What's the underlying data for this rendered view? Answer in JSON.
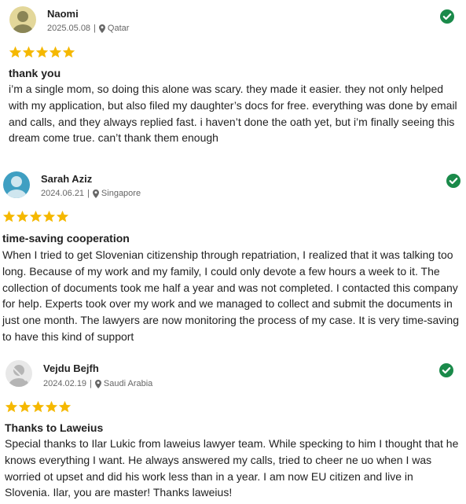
{
  "colors": {
    "star": "#f5b800",
    "verified": "#1a8a4a",
    "meta": "#666666"
  },
  "reviews": [
    {
      "name": "Naomi",
      "date": "2025.05.08",
      "country": "Qatar",
      "rating": 5,
      "title": "thank you",
      "text": "i’m a single mom, so doing this alone was scary. they made it easier. they not only helped with my application, but also filed my daughter’s docs for free. everything was done by email and calls, and they always replied fast. i haven’t done the oath yet, but i’m finally seeing this dream come true. can’t thank them enough",
      "verified_icon": "check-circle-icon"
    },
    {
      "name": "Sarah Aziz",
      "date": "2024.06.21",
      "country": "Singapore",
      "rating": 5,
      "title": "time-saving cooperation",
      "text": "When I tried to get Slovenian citizenship through repatriation, I realized that it was talking too long. Because of my work and my family, I could only devote a few hours a week to it. The collection of documents took me half a year and was not completed. I contacted this company for help. Experts took over my work and we managed to collect and submit the documents in just one month. The lawyers are now monitoring the process of my case. It is very time-saving to have this kind of support",
      "verified_icon": "check-circle-icon"
    },
    {
      "name": "Vejdu Bejfh",
      "date": "2024.02.19",
      "country": "Saudi Arabia",
      "rating": 5,
      "title": "Thanks to Laweius",
      "text": "Special thanks to Ilar Lukic from laweius lawyer team. While specking to him I thought that he knows everything I want. He always answered my calls, tried to cheer ne uo when I was worried ot upset and did his work less than in a year. I am now EU citizen and live in Slovenia. Ilar, you are master! Thanks laweius!",
      "verified_icon": "check-circle-icon"
    }
  ]
}
